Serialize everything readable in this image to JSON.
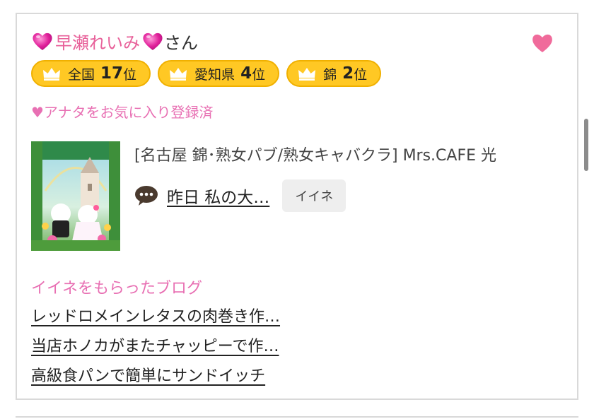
{
  "profile": {
    "name": "早瀬れいみ",
    "suffix": "さん",
    "name_icon": "pink-heart-emoji",
    "favorite_icon": "heart-icon",
    "colors": {
      "name": "#e8619a",
      "favorite_heart": "#f06b9b",
      "badge_fill": "#ffc824",
      "accent_pink": "#e870b3"
    }
  },
  "rankings": [
    {
      "area": "全国",
      "rank": "17",
      "unit": "位",
      "icon": "crown-icon"
    },
    {
      "area": "愛知県",
      "rank": "4",
      "unit": "位",
      "icon": "crown-icon"
    },
    {
      "area": "錦",
      "rank": "2",
      "unit": "位",
      "icon": "crown-icon"
    }
  ],
  "favorite_status": "♥アナタをお気に入り登録済",
  "post": {
    "shop": "[名古屋 錦･熟女パブ/熟女キャバクラ]  Mrs.CAFE 光",
    "blog_title": "昨日 私の大…",
    "blog_icon": "chat-bubble-icon",
    "iine_label": "イイネ"
  },
  "liked_blogs": {
    "title": "イイネをもらったブログ",
    "items": [
      "レッドロメインレタスの肉巻き作…",
      "当店ホノカがまたチャッピーで作…",
      "高級食パンで簡単にサンドイッチ"
    ]
  }
}
